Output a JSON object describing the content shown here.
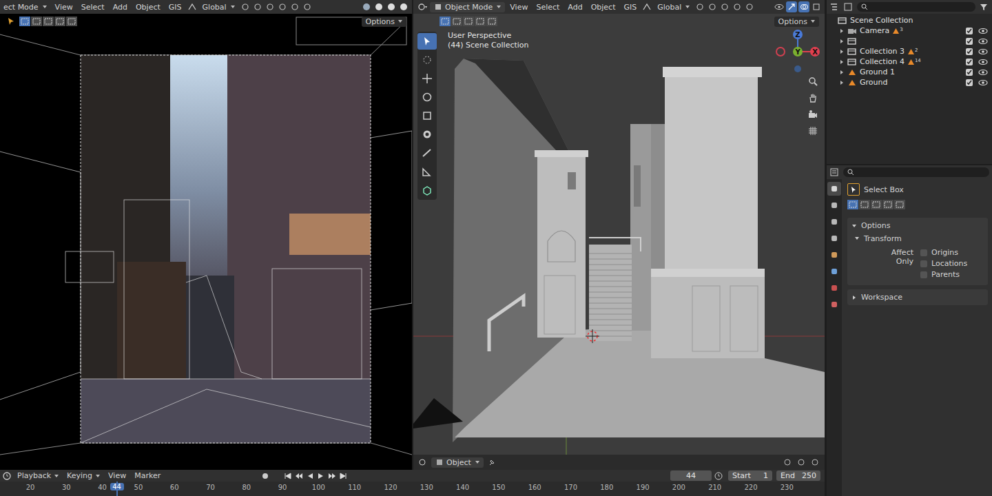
{
  "left_viewport": {
    "mode": "ect Mode",
    "menus": [
      "View",
      "Select",
      "Add",
      "Object",
      "GIS"
    ],
    "orientation": "Global",
    "options": "Options",
    "select_modes": [
      {
        "selected": true
      },
      {
        "selected": false
      },
      {
        "selected": false
      },
      {
        "selected": false
      },
      {
        "selected": false
      }
    ]
  },
  "right_viewport": {
    "mode": "Object Mode",
    "menus": [
      "View",
      "Select",
      "Add",
      "Object",
      "GIS"
    ],
    "orientation": "Global",
    "options": "Options",
    "view_name": "User Perspective",
    "collection": "(44) Scene Collection",
    "axes": {
      "x": "X",
      "y": "Y",
      "z": "Z"
    },
    "footer_mode": "Object",
    "select_modes": [
      {
        "selected": true
      },
      {
        "selected": false
      },
      {
        "selected": false
      },
      {
        "selected": false
      },
      {
        "selected": false
      }
    ],
    "tools": [
      {
        "selected": true
      },
      {
        "selected": false
      },
      {
        "selected": false
      },
      {
        "selected": false
      },
      {
        "selected": false
      },
      {
        "selected": false
      },
      {
        "selected": false
      },
      {
        "selected": false
      },
      {
        "selected": false
      }
    ]
  },
  "outliner": {
    "root": "Scene Collection",
    "items": [
      {
        "name": "Camera",
        "kind": "camera",
        "expanded": false,
        "count": "3",
        "checked": true,
        "visible": true
      },
      {
        "name": "",
        "kind": "collection",
        "expanded": false,
        "count": "",
        "checked": true,
        "visible": true
      },
      {
        "name": "Collection 3",
        "kind": "collection",
        "expanded": false,
        "count": "2",
        "checked": true,
        "visible": true
      },
      {
        "name": "Collection 4",
        "kind": "collection",
        "expanded": false,
        "count": "14",
        "checked": true,
        "visible": true
      },
      {
        "name": "Ground 1",
        "kind": "mesh",
        "expanded": false,
        "count": "",
        "checked": true,
        "visible": true
      },
      {
        "name": "Ground",
        "kind": "mesh",
        "expanded": false,
        "count": "",
        "checked": true,
        "visible": true
      }
    ]
  },
  "properties": {
    "tabs": [
      {
        "selected": true
      },
      {
        "selected": false
      },
      {
        "selected": false
      },
      {
        "selected": false
      },
      {
        "selected": false
      },
      {
        "selected": false
      },
      {
        "selected": false
      },
      {
        "selected": false
      }
    ],
    "tool": "Select Box",
    "select_modes": [
      {
        "selected": true
      },
      {
        "selected": false
      },
      {
        "selected": false
      },
      {
        "selected": false
      },
      {
        "selected": false
      }
    ],
    "options": "Options",
    "options_expanded": true,
    "transform": "Transform",
    "transform_expanded": true,
    "affect_only": "Affect Only",
    "checkboxes": [
      {
        "label": "Origins",
        "checked": false
      },
      {
        "label": "Locations",
        "checked": false
      },
      {
        "label": "Parents",
        "checked": false
      }
    ],
    "workspace": "Workspace",
    "workspace_expanded": false
  },
  "timeline": {
    "menus": [
      "Playback",
      "Keying",
      "View",
      "Marker"
    ],
    "current_frame": "44",
    "start_label": "Start",
    "start": "1",
    "end_label": "End",
    "end": "250",
    "ticks": [
      "20",
      "30",
      "40",
      "50",
      "60",
      "70",
      "80",
      "90",
      "100",
      "110",
      "120",
      "130",
      "140",
      "150",
      "160",
      "170",
      "180",
      "190",
      "200",
      "210",
      "220",
      "230"
    ]
  }
}
